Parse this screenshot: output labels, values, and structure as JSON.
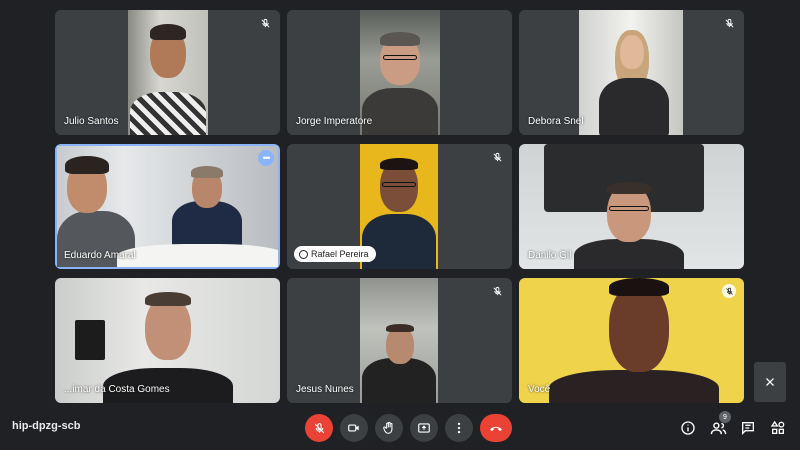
{
  "participants": [
    {
      "name": "Julio Santos",
      "muted": true
    },
    {
      "name": "Jorge Imperatore",
      "muted": false
    },
    {
      "name": "Debora Snel",
      "muted": true
    },
    {
      "name": "Eduardo Amaral",
      "muted": false,
      "active_speaker": true
    },
    {
      "name": "Rafael Pereira",
      "muted": true,
      "pinned_style": true
    },
    {
      "name": "Danilo Gil",
      "muted": false
    },
    {
      "name": "Aimar da Costa Gomes",
      "display_name": "...imar da Costa Gomes",
      "muted": false
    },
    {
      "name": "Jesus Nunes",
      "muted": true
    },
    {
      "name": "Você",
      "muted": true
    }
  ],
  "more_options_label": "•••",
  "bottom_bar": {
    "meeting_code": "hip-dpzg-scb",
    "controls": [
      "mic-off-icon",
      "camera-icon",
      "raise-hand-icon",
      "present-icon",
      "more-vert-icon",
      "hangup-icon"
    ],
    "participants_count": "9",
    "accent_colors": {
      "danger": "#ea4335",
      "active": "#8ab4f8",
      "tile": "#3c4043",
      "background": "#202124"
    }
  }
}
